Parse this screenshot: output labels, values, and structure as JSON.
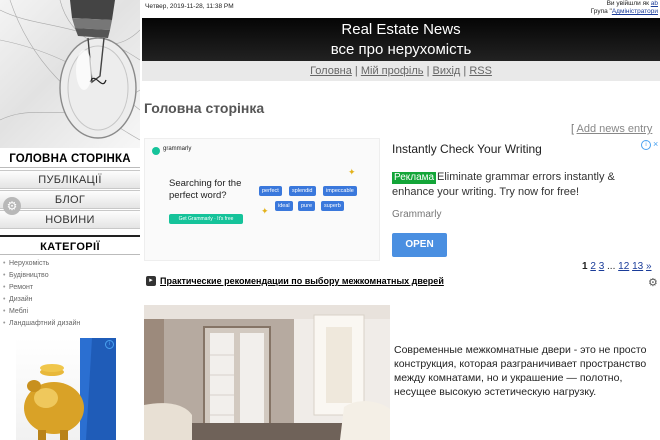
{
  "topbar": {
    "datetime": "Четвер, 2019-11-28, 11:38 PM",
    "login_prefix": "Ви увійшли як",
    "login_user": "ab",
    "group_prefix": "Група \"",
    "group_name": "Адміністратори"
  },
  "header": {
    "title": "Real Estate News",
    "subtitle": "все про нерухомість"
  },
  "nav": {
    "items": [
      "Головна",
      "Мій профіль",
      "Вихід",
      "RSS"
    ],
    "separator": "|"
  },
  "sidebar": {
    "main_heading": "ГОЛОВНА СТОРІНКА",
    "buttons": [
      "ПУБЛІКАЦІЇ",
      "БЛОГ",
      "НОВИНИ"
    ],
    "categories_heading": "КАТЕГОРІЇ",
    "categories": [
      "Нерухомість",
      "Будівництво",
      "Ремонт",
      "Дизайн",
      "Меблі",
      "Ландшафтний дизайн"
    ]
  },
  "page": {
    "title": "Головна сторінка",
    "add_news_bracket": "[",
    "add_news": "Add news entry"
  },
  "ad": {
    "grammarly_name": "grammarly",
    "question_line1": "Searching for the",
    "question_line2": "perfect word?",
    "cta_small": "Get Grammarly · It's free",
    "chips": [
      "perfect",
      "splendid",
      "impeccable",
      "ideal",
      "pure",
      "superb"
    ],
    "title": "Instantly Check Your Writing",
    "badge": "Реклама",
    "body": "Eliminate grammar errors instantly & enhance your writing. Try now for free!",
    "brand": "Grammarly",
    "open_label": "OPEN",
    "close_symbol": "×"
  },
  "pager": {
    "current": "1",
    "pages": [
      "2",
      "3"
    ],
    "ellipsis": "...",
    "later": [
      "12",
      "13"
    ],
    "next": "»"
  },
  "article": {
    "title": "Практические рекомендации по выбору межкомнатных дверей",
    "text": "Современные межкомнатные двери - это не просто конструкция, которая разграничивает пространство между комнатами, но и украшение — полотно, несущее высокую эстетическую нагрузку."
  }
}
